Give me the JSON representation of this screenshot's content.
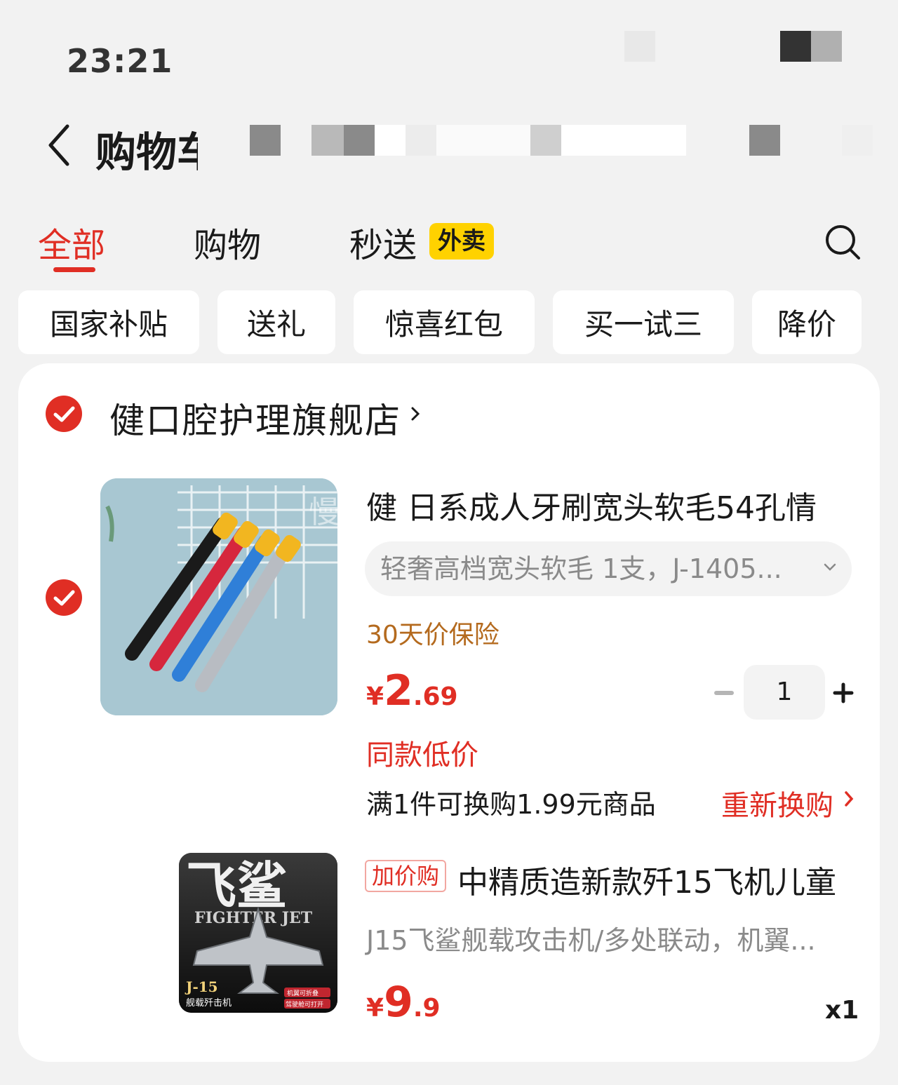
{
  "status_bar": {
    "time": "23:21"
  },
  "header": {
    "title": "购物车"
  },
  "tabs": [
    {
      "label": "全部",
      "active": true
    },
    {
      "label": "购物",
      "active": false
    },
    {
      "label": "秒送",
      "active": false,
      "badge": "外卖"
    }
  ],
  "filters": [
    "国家补贴",
    "送礼",
    "惊喜红包",
    "买一试三",
    "降价"
  ],
  "store": {
    "name": "健口腔护理旗舰店",
    "checked": true
  },
  "items": [
    {
      "checked": true,
      "title": "健 日系成人牙刷宽头软毛54孔情",
      "watermark": "慢星",
      "spec": "轻奢高档宽头软毛 1支，J-1405...",
      "guarantee": "30天价保险",
      "price": {
        "yen": "¥",
        "int": "2",
        "dec": ".69"
      },
      "quantity": "1",
      "price_tag": "同款低价",
      "exchange": {
        "text": "满1件可换购1.99元商品",
        "action": "重新换购"
      }
    },
    {
      "badge": "加价购",
      "title": "中精质造新款歼15飞机儿童",
      "subtitle": "J15飞鲨舰载攻击机/多处联动，机翼...",
      "price": {
        "yen": "¥",
        "int": "9",
        "dec": ".9"
      },
      "quantity_text": "x1",
      "image_text": {
        "main": "飞鲨",
        "line": "FIGHTER JET",
        "model": "J-15",
        "caption": "舰载歼击机",
        "tag1": "机翼可折叠",
        "tag2": "驾驶舱可打开"
      }
    }
  ],
  "colors": {
    "accent": "#e02e24",
    "guarantee": "#b46a1e",
    "badge_yellow": "#ffd200"
  }
}
